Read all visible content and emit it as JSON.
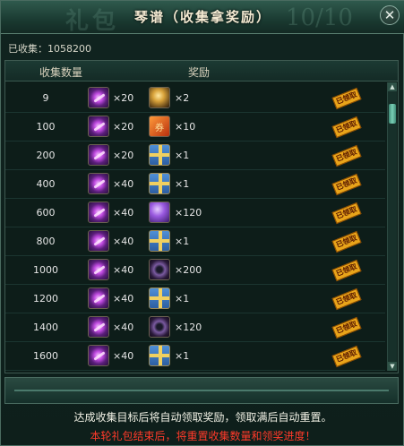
{
  "window": {
    "title": "琴谱（收集拿奖励）",
    "ghost_title": "礼包",
    "ghost_progress": "10/10",
    "close_label": "✕"
  },
  "collected": "已收集：1058200",
  "columns": {
    "count": "收集数量",
    "reward": "奖励"
  },
  "claimed_label": "已领取",
  "rows": [
    {
      "count": "9",
      "qty1": "×20",
      "reward_icon": "gold-orb-icon",
      "qty2": "×2"
    },
    {
      "count": "100",
      "qty1": "×20",
      "reward_icon": "coupon-icon",
      "qty2": "×10"
    },
    {
      "count": "200",
      "qty1": "×20",
      "reward_icon": "gift-box-icon",
      "qty2": "×1"
    },
    {
      "count": "400",
      "qty1": "×40",
      "reward_icon": "gift-box-icon",
      "qty2": "×1"
    },
    {
      "count": "600",
      "qty1": "×40",
      "reward_icon": "purple-pearl-icon",
      "qty2": "×120"
    },
    {
      "count": "800",
      "qty1": "×40",
      "reward_icon": "gift-box-icon",
      "qty2": "×1"
    },
    {
      "count": "1000",
      "qty1": "×40",
      "reward_icon": "dragon-amulet-icon",
      "qty2": "×200"
    },
    {
      "count": "1200",
      "qty1": "×40",
      "reward_icon": "gift-box-icon",
      "qty2": "×1"
    },
    {
      "count": "1400",
      "qty1": "×40",
      "reward_icon": "dragon-amulet-icon",
      "qty2": "×120"
    },
    {
      "count": "1600",
      "qty1": "×40",
      "reward_icon": "gift-box-icon",
      "qty2": "×1"
    }
  ],
  "notes": {
    "line1": "达成收集目标后将自动领取奖励，领取满后自动重置。",
    "line2": "本轮礼包结束后，将重置收集数量和领奖进度！"
  },
  "colors": {
    "accent": "#e8a41a",
    "warning": "#ff3a2a",
    "panel": "#0e1f1b"
  }
}
